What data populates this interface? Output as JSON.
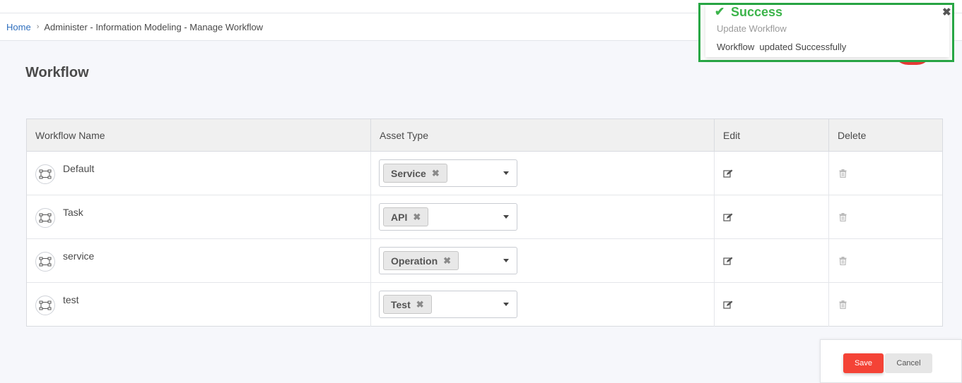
{
  "breadcrumb": {
    "home": "Home",
    "separator": "›",
    "current": "Administer - Information Modeling - Manage Workflow"
  },
  "page": {
    "title": "Workflow"
  },
  "table": {
    "headers": [
      "Workflow Name",
      "Asset Type",
      "Edit",
      "Delete"
    ],
    "rows": [
      {
        "name": "Default",
        "asset_type": "Service"
      },
      {
        "name": "Task",
        "asset_type": "API"
      },
      {
        "name": "service",
        "asset_type": "Operation"
      },
      {
        "name": "test",
        "asset_type": "Test"
      }
    ]
  },
  "toast": {
    "title": "Success",
    "subtitle": "Update Workflow",
    "message": "Workflow  updated Successfully",
    "icon": "check-icon",
    "close_icon": "close-icon",
    "color": "#3cb44b",
    "highlight_color": "#28a745"
  },
  "actions": {
    "save_label": "Save",
    "cancel_label": "Cancel",
    "save_color": "#f44336"
  },
  "icons": {
    "tag_remove": "✖",
    "check": "✔",
    "close": "✖"
  }
}
